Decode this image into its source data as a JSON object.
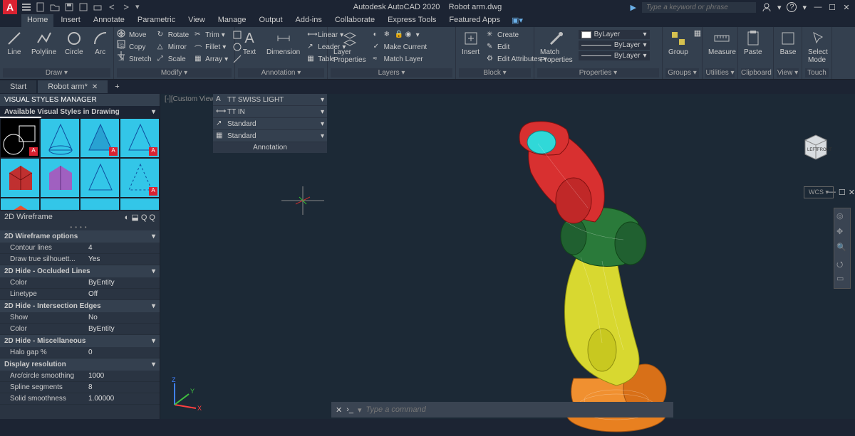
{
  "app": {
    "title": "Autodesk AutoCAD 2020",
    "doc": "Robot arm.dwg"
  },
  "search": {
    "placeholder": "Type a keyword or phrase"
  },
  "menu": {
    "tabs": [
      "Home",
      "Insert",
      "Annotate",
      "Parametric",
      "View",
      "Manage",
      "Output",
      "Add-ins",
      "Collaborate",
      "Express Tools",
      "Featured Apps"
    ],
    "active": 0
  },
  "ribbon": {
    "draw": {
      "label": "Draw",
      "items": [
        "Line",
        "Polyline",
        "Circle",
        "Arc"
      ]
    },
    "modify": {
      "label": "Modify",
      "rows": [
        [
          "Move",
          "Rotate",
          "Trim"
        ],
        [
          "Copy",
          "Mirror",
          "Fillet"
        ],
        [
          "Stretch",
          "Scale",
          "Array"
        ]
      ]
    },
    "annot": {
      "label": "Annotation",
      "text": "Text",
      "dim": "Dimension",
      "rows": [
        "Linear",
        "Leader",
        "Table"
      ]
    },
    "layers": {
      "label": "Layers",
      "lp": "Layer\nProperties",
      "rows": [
        "Make Current",
        "Match Layer"
      ]
    },
    "block": {
      "label": "Block",
      "insert": "Insert",
      "rows": [
        "Create",
        "Edit",
        "Edit Attributes"
      ]
    },
    "props": {
      "label": "Properties",
      "mp": "Match\nProperties",
      "bylayer": "ByLayer"
    },
    "groups": {
      "label": "Groups",
      "g": "Group"
    },
    "util": {
      "label": "Utilities",
      "m": "Measure"
    },
    "clip": {
      "label": "Clipboard",
      "p": "Paste"
    },
    "view": {
      "label": "View",
      "b": "Base"
    },
    "touch": {
      "label": "Touch",
      "s": "Select\nMode"
    }
  },
  "filetabs": {
    "start": "Start",
    "doc": "Robot arm*"
  },
  "annot_drop": {
    "items": [
      "TT SWISS LIGHT",
      "TT IN",
      "Standard",
      "Standard"
    ],
    "label": "Annotation"
  },
  "panel": {
    "title": "VISUAL STYLES MANAGER",
    "header": "Available Visual Styles in Drawing",
    "current": "2D Wireframe",
    "sections": [
      {
        "title": "2D Wireframe options",
        "rows": [
          [
            "Contour lines",
            "4"
          ],
          [
            "Draw true silhouett...",
            "Yes"
          ]
        ]
      },
      {
        "title": "2D Hide - Occluded Lines",
        "rows": [
          [
            "Color",
            "ByEntity"
          ],
          [
            "Linetype",
            "Off"
          ]
        ]
      },
      {
        "title": "2D Hide - Intersection Edges",
        "rows": [
          [
            "Show",
            "No"
          ],
          [
            "Color",
            "ByEntity"
          ]
        ]
      },
      {
        "title": "2D Hide - Miscellaneous",
        "rows": [
          [
            "Halo gap %",
            "0"
          ]
        ]
      },
      {
        "title": "Display resolution",
        "rows": [
          [
            "Arc/circle smoothing",
            "1000"
          ],
          [
            "Spline segments",
            "8"
          ],
          [
            "Solid smoothness",
            "1.00000"
          ]
        ]
      }
    ]
  },
  "viewport": {
    "label": "[-][Custom View",
    "wcs": "WCS",
    "cube": {
      "left": "LEFT",
      "front": "FRONT"
    }
  },
  "cmd": {
    "placeholder": "Type a command"
  },
  "axis": {
    "x": "X",
    "y": "Y",
    "z": "Z"
  }
}
